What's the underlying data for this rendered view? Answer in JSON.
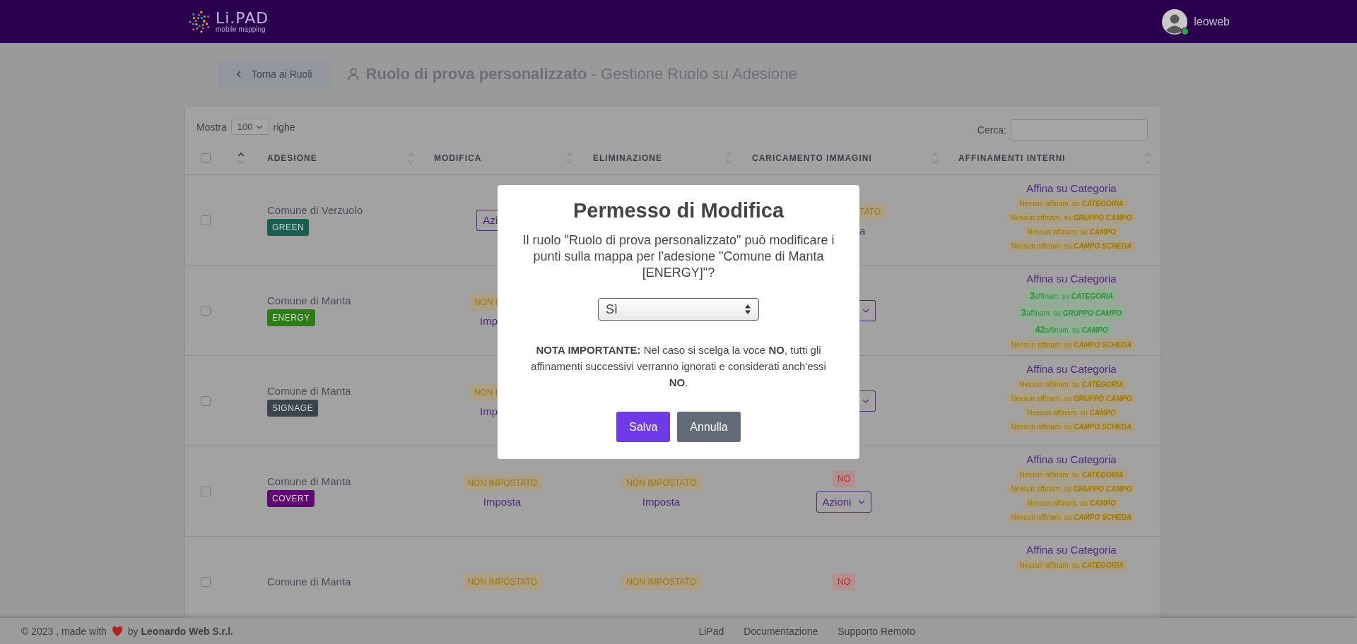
{
  "header": {
    "logo": {
      "name": "Li.PAD",
      "tagline": "mobile mapping"
    },
    "user": {
      "name": "leoweb",
      "online": true
    }
  },
  "toolbar": {
    "back_button": "Torna ai Ruoli",
    "title": "**Ruolo di prova personalizzato** - Gestione Ruolo su Adesione"
  },
  "table_controls": {
    "show_label": "Mostra",
    "page_size": "100",
    "rows_label": "righe",
    "search_label": "Cerca:"
  },
  "table": {
    "columns": [
      {
        "kind": "checkbox",
        "checked": false
      },
      {
        "kind": "sort",
        "sorted": true
      },
      {
        "kind": "text",
        "label": "ADESIONE",
        "sorted": false
      },
      {
        "kind": "text",
        "label": "MODIFICA",
        "sorted": false
      },
      {
        "kind": "text",
        "label": "ELIMINAZIONE",
        "sorted": false
      },
      {
        "kind": "text",
        "label": "CARICAMENTO IMMAGINI",
        "sorted": false
      },
      {
        "kind": "text",
        "label": "AFFINAMENTI INTERNI",
        "sorted": false
      }
    ],
    "rows": [
      {
        "checked": false,
        "name": "Comune di Verzuolo",
        "tag": {
          "label": "GREEN",
          "color": "#1b5e50"
        },
        "modifica": {
          "covered_right": true,
          "items": [
            {
              "kind": "select",
              "text": "Azi"
            }
          ]
        },
        "caricamento": {
          "covered_left": true,
          "items": [
            {
              "kind": "warn",
              "text": "TATO"
            },
            {
              "kind": "link",
              "text": "a"
            }
          ]
        },
        "affinamenti": {
          "title": "Affina su Categoria",
          "items": [
            {
              "set": false,
              "text": "Nessun affinam. su",
              "target": "CATEGORIA"
            },
            {
              "set": false,
              "text": "Nessun affinam. su",
              "target": "GRUPPO CAMPO"
            },
            {
              "set": false,
              "text": "Nessun affinam. su",
              "target": "CAMPO"
            },
            {
              "set": false,
              "text": "Nessun affinam. su",
              "target": "CAMPO SCHEDA"
            }
          ]
        }
      },
      {
        "checked": false,
        "name": "Comune di Manta",
        "tag": {
          "label": "ENERGY",
          "color": "#2f7a1a"
        },
        "modifica": {
          "covered_right": true,
          "items": [
            {
              "kind": "warn",
              "text": "NON I"
            },
            {
              "kind": "link",
              "text": "Imp"
            }
          ]
        },
        "caricamento": {
          "covered_left": true,
          "items": [
            {
              "kind": "select"
            }
          ]
        },
        "affinamenti": {
          "title": "Affina su Categoria",
          "items": [
            {
              "set": true,
              "count": "3",
              "text": "affinam. su",
              "target": "CATEGORIA"
            },
            {
              "set": true,
              "count": "3",
              "text": "affinam. su",
              "target": "GRUPPO CAMPO"
            },
            {
              "set": true,
              "count": "42",
              "text": "affinam. su",
              "target": "CAMPO"
            },
            {
              "set": false,
              "text": "Nessun affinam. su",
              "target": "CAMPO SCHEDA"
            }
          ]
        }
      },
      {
        "checked": false,
        "name": "Comune di Manta",
        "tag": {
          "label": "SIGNAGE",
          "color": "#3a4550"
        },
        "modifica": {
          "covered_right": true,
          "items": [
            {
              "kind": "warn",
              "text": "NON I"
            },
            {
              "kind": "link",
              "text": "Imp"
            }
          ]
        },
        "caricamento": {
          "covered_left": true,
          "items": [
            {
              "kind": "select"
            }
          ]
        },
        "affinamenti": {
          "title": "Affina su Categoria",
          "items": [
            {
              "set": false,
              "text": "Nessun affinam. su",
              "target": "CATEGORIA"
            },
            {
              "set": false,
              "text": "Nessun affinam. su",
              "target": "GRUPPO CAMPO"
            },
            {
              "set": false,
              "text": "Nessun affinam. su",
              "target": "CAMPO"
            },
            {
              "set": false,
              "text": "Nessun affinam. su",
              "target": "CAMPO SCHEDA"
            }
          ]
        }
      },
      {
        "checked": false,
        "name": "Comune di Manta",
        "tag": {
          "label": "COVERT",
          "color": "#5e0a70"
        },
        "modifica": {
          "items": [
            {
              "kind": "warn",
              "text": "NON IMPOSTATO"
            },
            {
              "kind": "link",
              "text": "Imposta"
            }
          ]
        },
        "eliminazione": {
          "items": [
            {
              "kind": "warn",
              "text": "NON IMPOSTATO"
            },
            {
              "kind": "link",
              "text": "Imposta"
            }
          ]
        },
        "caricamento": {
          "items": [
            {
              "kind": "no",
              "text": "NO"
            },
            {
              "kind": "select",
              "text": "Azioni"
            }
          ]
        },
        "affinamenti": {
          "title": "Affina su Categoria",
          "items": [
            {
              "set": false,
              "text": "Nessun affinam. su",
              "target": "CATEGORIA"
            },
            {
              "set": false,
              "text": "Nessun affinam. su",
              "target": "GRUPPO CAMPO"
            },
            {
              "set": false,
              "text": "Nessun affinam. su",
              "target": "CAMPO"
            },
            {
              "set": false,
              "text": "Nessun affinam. su",
              "target": "CAMPO SCHEDA"
            }
          ]
        }
      },
      {
        "checked": false,
        "name": "Comune di Manta",
        "modifica": {
          "items": [
            {
              "kind": "warn",
              "text": "NON IMPOSTATO"
            }
          ]
        },
        "eliminazione": {
          "items": [
            {
              "kind": "warn",
              "text": "NON IMPOSTATO"
            }
          ]
        },
        "caricamento": {
          "items": [
            {
              "kind": "no",
              "text": "NO"
            }
          ]
        },
        "affinamenti": {
          "title": "Affina su Categoria",
          "items": [
            {
              "set": false,
              "text": "Nessun affinam. su",
              "target": "CATEGORIA"
            }
          ]
        }
      }
    ]
  },
  "modal": {
    "title": "Permesso di Modifica",
    "question": "Il ruolo \"Ruolo di prova personalizzato\" può modificare i punti sulla mappa per l'adesione \"Comune di Manta [ENERGY]\"?",
    "select": {
      "value": "Sì"
    },
    "note": "**NOTA IMPORTANTE:** Nel caso si scelga la voce **NO**, tutti gli affinamenti successivi verranno ignorati e considerati anch'essi **NO**.",
    "buttons": [
      {
        "label": "Salva",
        "kind": "primary"
      },
      {
        "label": "Annulla",
        "kind": "secondary"
      }
    ]
  },
  "footer": {
    "copyright": "© 2023 , made with",
    "credit": "by **Leonardo Web S.r.l.**",
    "links": [
      "LiPad",
      "Documentazione",
      "Supporto Remoto"
    ]
  }
}
